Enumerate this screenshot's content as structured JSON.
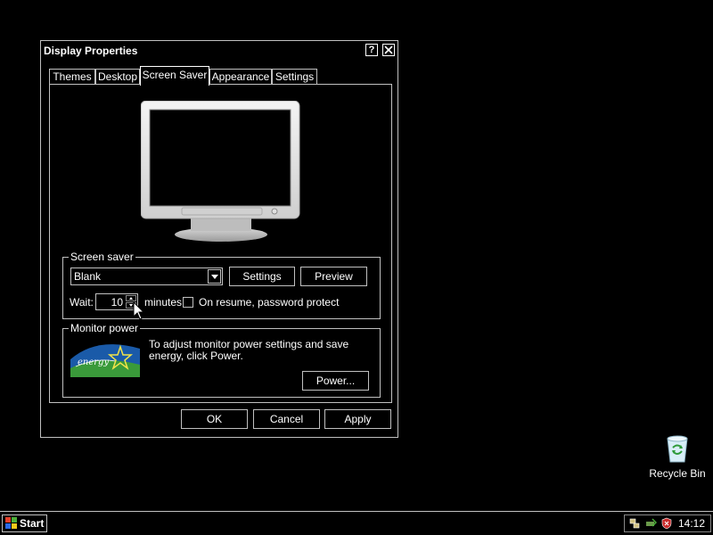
{
  "dialog": {
    "title": "Display Properties",
    "help_glyph": "?",
    "close_glyph": "✕",
    "tabs": [
      {
        "label": "Themes"
      },
      {
        "label": "Desktop"
      },
      {
        "label": "Screen Saver",
        "active": true
      },
      {
        "label": "Appearance"
      },
      {
        "label": "Settings"
      }
    ],
    "screen_saver": {
      "group_label": "Screen saver",
      "selected": "Blank",
      "settings_button": "Settings",
      "preview_button": "Preview",
      "wait_label": "Wait:",
      "wait_value": "10",
      "minutes_label": "minutes",
      "password_label": "On resume, password protect",
      "password_checked": false
    },
    "monitor_power": {
      "group_label": "Monitor power",
      "description": "To adjust monitor power settings and save energy, click Power.",
      "power_button": "Power..."
    },
    "buttons": {
      "ok": "OK",
      "cancel": "Cancel",
      "apply": "Apply"
    }
  },
  "desktop": {
    "icons": [
      {
        "label": "Recycle Bin",
        "icon": "recycle-bin-icon"
      }
    ]
  },
  "taskbar": {
    "start_label": "Start",
    "clock": "14:12",
    "tray_icons": [
      "network-icon",
      "safely-remove-icon",
      "security-shield-icon"
    ]
  },
  "colors": {
    "background": "#000000",
    "border": "#c0c0c0",
    "text": "#ffffff",
    "energy_blue": "#1a5aa8",
    "energy_green": "#3a9a3a"
  }
}
